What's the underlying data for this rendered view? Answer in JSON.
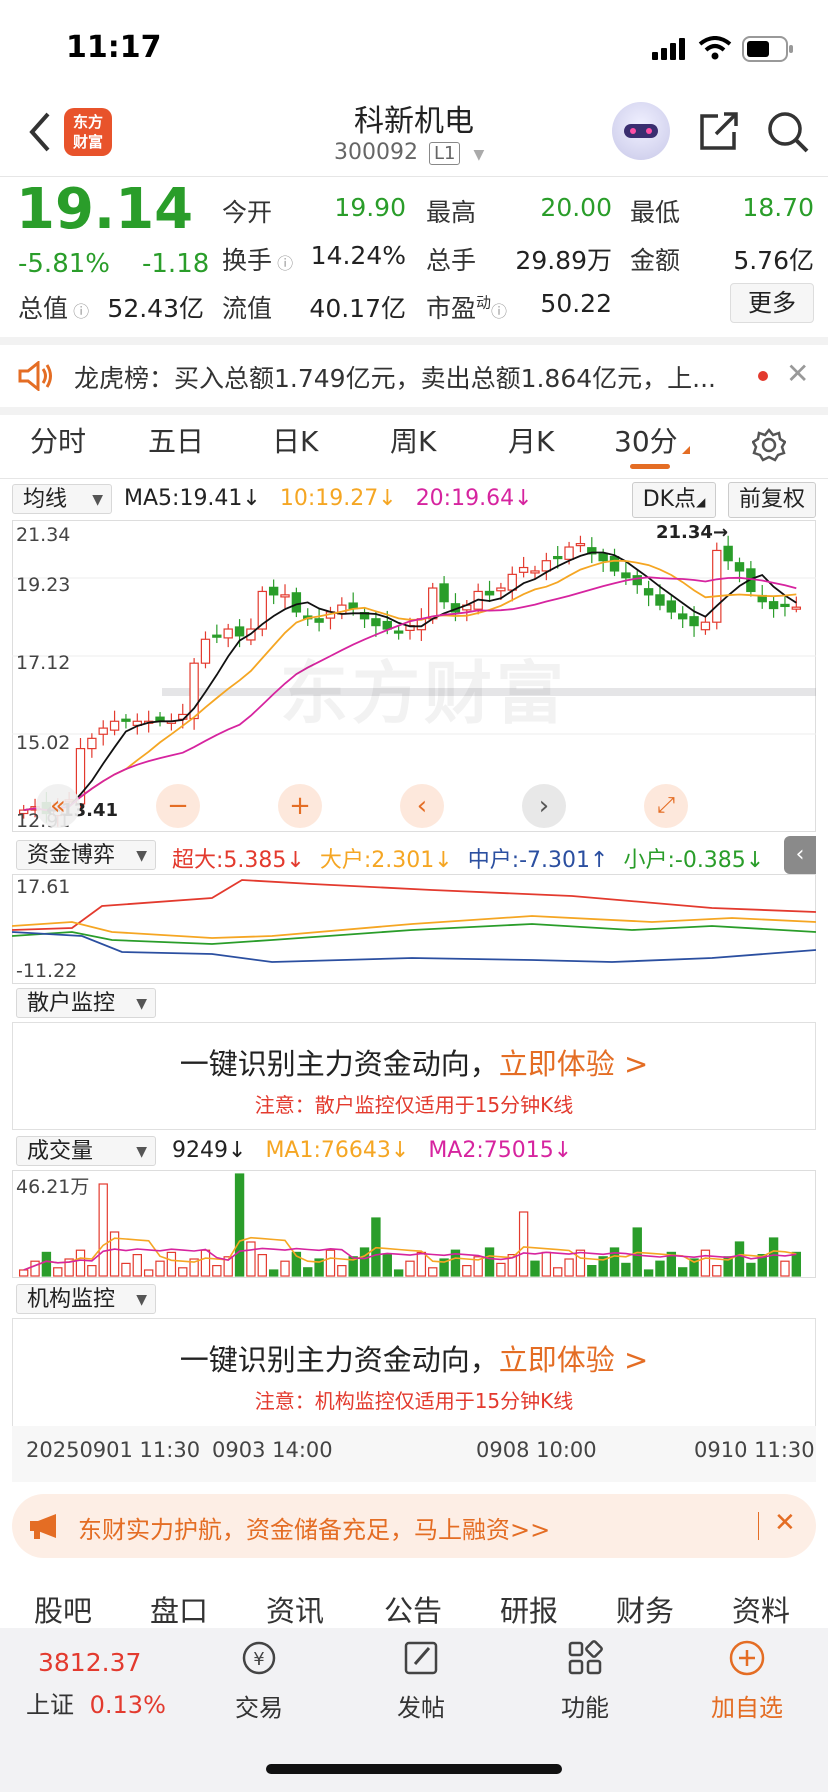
{
  "status_bar": {
    "time": "11:17"
  },
  "header": {
    "logo_text_1": "东方",
    "logo_text_2": "财富",
    "title": "科新机电",
    "code": "300092",
    "level": "L1"
  },
  "quote": {
    "price": "19.14",
    "change_pct": "-5.81%",
    "change": "-1.18",
    "open_label": "今开",
    "open": "19.90",
    "high_label": "最高",
    "high": "20.00",
    "low_label": "最低",
    "low": "18.70",
    "turnover_label": "换手",
    "turnover": "14.24%",
    "volume_label": "总手",
    "volume": "29.89万",
    "amount_label": "金额",
    "amount": "5.76亿",
    "mktcap_label": "总值",
    "mktcap": "52.43亿",
    "float_label": "流值",
    "float": "40.17亿",
    "pe_label": "市盈",
    "pe_sup": "动",
    "pe": "50.22",
    "more_label": "更多"
  },
  "notice": {
    "text": "龙虎榜：买入总额1.749亿元，卖出总额1.864亿元，上..."
  },
  "tabs": [
    "分时",
    "五日",
    "日K",
    "周K",
    "月K",
    "30分"
  ],
  "kline": {
    "indicator": "均线",
    "ma5": "MA5:19.41",
    "ma10": "10:19.27",
    "ma20": "20:19.64",
    "dk_label": "DK点",
    "adjust_label": "前复权",
    "y_labels": [
      "21.34",
      "19.23",
      "17.12",
      "15.02",
      "12.91"
    ],
    "max_marker": "21.34",
    "min_marker": "13.41",
    "watermark": "东方财富"
  },
  "fund": {
    "indicator": "资金博弈",
    "super": "超大:5.385",
    "large": "大户:2.301",
    "medium": "中户:-7.301",
    "small": "小户:-0.385",
    "y_top": "17.61",
    "y_bottom": "-11.22"
  },
  "retail": {
    "indicator": "散户监控",
    "promo_main": "一键识别主力资金动向，",
    "promo_action": "立即体验 >",
    "promo_note": "注意：散户监控仅适用于15分钟K线"
  },
  "volume": {
    "indicator": "成交量",
    "value": "9249",
    "ma1": "MA1:76643",
    "ma2": "MA2:75015",
    "y_top": "46.21万"
  },
  "institution": {
    "indicator": "机构监控",
    "promo_main": "一键识别主力资金动向，",
    "promo_action": "立即体验 >",
    "promo_note": "注意：机构监控仅适用于15分钟K线"
  },
  "time_axis": [
    "20250901 11:30",
    "0903 14:00",
    "0908 10:00",
    "0910 11:30"
  ],
  "banner": {
    "text": "东财实力护航，资金储备充足，马上融资>>"
  },
  "bottom_tabs": [
    "股吧",
    "盘口",
    "资讯",
    "公告",
    "研报",
    "财务",
    "资料"
  ],
  "nav": {
    "index_value": "3812.37",
    "index_name": "上证",
    "index_change": "0.13%",
    "items": [
      "交易",
      "发帖",
      "功能",
      "加自选"
    ]
  },
  "chart_data": {
    "type": "candlestick",
    "ylim": [
      12.91,
      21.34
    ],
    "candles_approx_close": [
      13.2,
      13.3,
      13.1,
      13.4,
      13.5,
      15.0,
      15.3,
      15.6,
      15.8,
      15.8,
      15.8,
      15.8,
      15.8,
      15.8,
      16.0,
      17.5,
      18.2,
      18.3,
      18.5,
      18.3,
      18.5,
      19.6,
      19.5,
      19.5,
      19.0,
      18.8,
      18.7,
      19.0,
      19.2,
      19.1,
      18.8,
      18.6,
      18.5,
      18.4,
      18.6,
      18.8,
      19.7,
      19.3,
      19.0,
      19.2,
      19.6,
      19.5,
      19.7,
      20.1,
      20.3,
      20.2,
      20.5,
      20.6,
      20.9,
      21.0,
      20.7,
      20.5,
      20.2,
      20.0,
      19.8,
      19.5,
      19.2,
      19.0,
      18.8,
      18.6,
      18.7,
      20.8,
      20.5,
      20.2,
      19.6,
      19.3,
      19.1,
      19.2,
      19.14
    ]
  }
}
